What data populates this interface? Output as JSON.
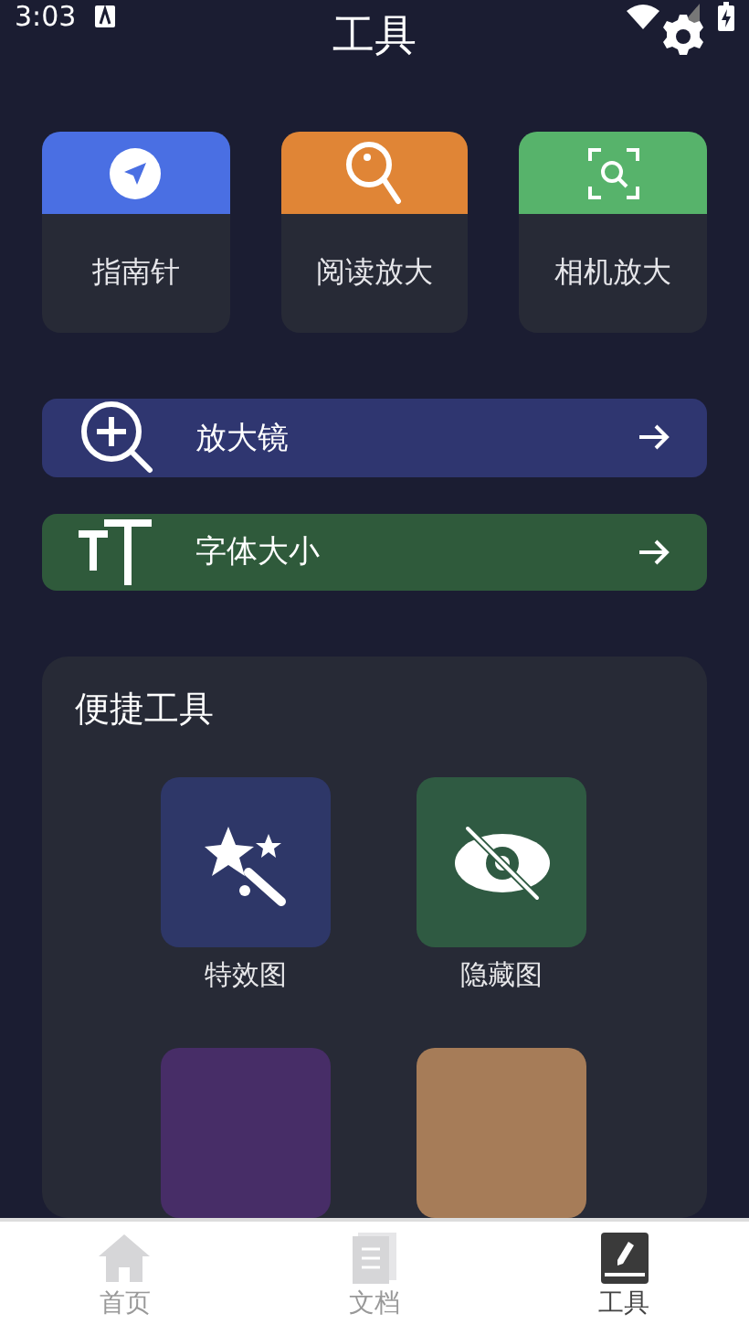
{
  "status_bar": {
    "time": "3:03"
  },
  "header": {
    "title": "工具"
  },
  "tools": [
    {
      "label": "指南针",
      "color": "#4a6fe3"
    },
    {
      "label": "阅读放大",
      "color": "#e08536"
    },
    {
      "label": "相机放大",
      "color": "#57b36b"
    }
  ],
  "banners": [
    {
      "label": "放大镜",
      "color": "#2f3670"
    },
    {
      "label": "字体大小",
      "color": "#2f5a3b"
    }
  ],
  "quick_tools": {
    "title": "便捷工具",
    "items": [
      {
        "label": "特效图",
        "color": "#2e3768"
      },
      {
        "label": "隐藏图",
        "color": "#2f5a42"
      },
      {
        "color": "#472d67"
      },
      {
        "color": "#a67c58"
      }
    ]
  },
  "nav": [
    {
      "label": "首页",
      "selected": false
    },
    {
      "label": "文档",
      "selected": false
    },
    {
      "label": "工具",
      "selected": true
    }
  ]
}
